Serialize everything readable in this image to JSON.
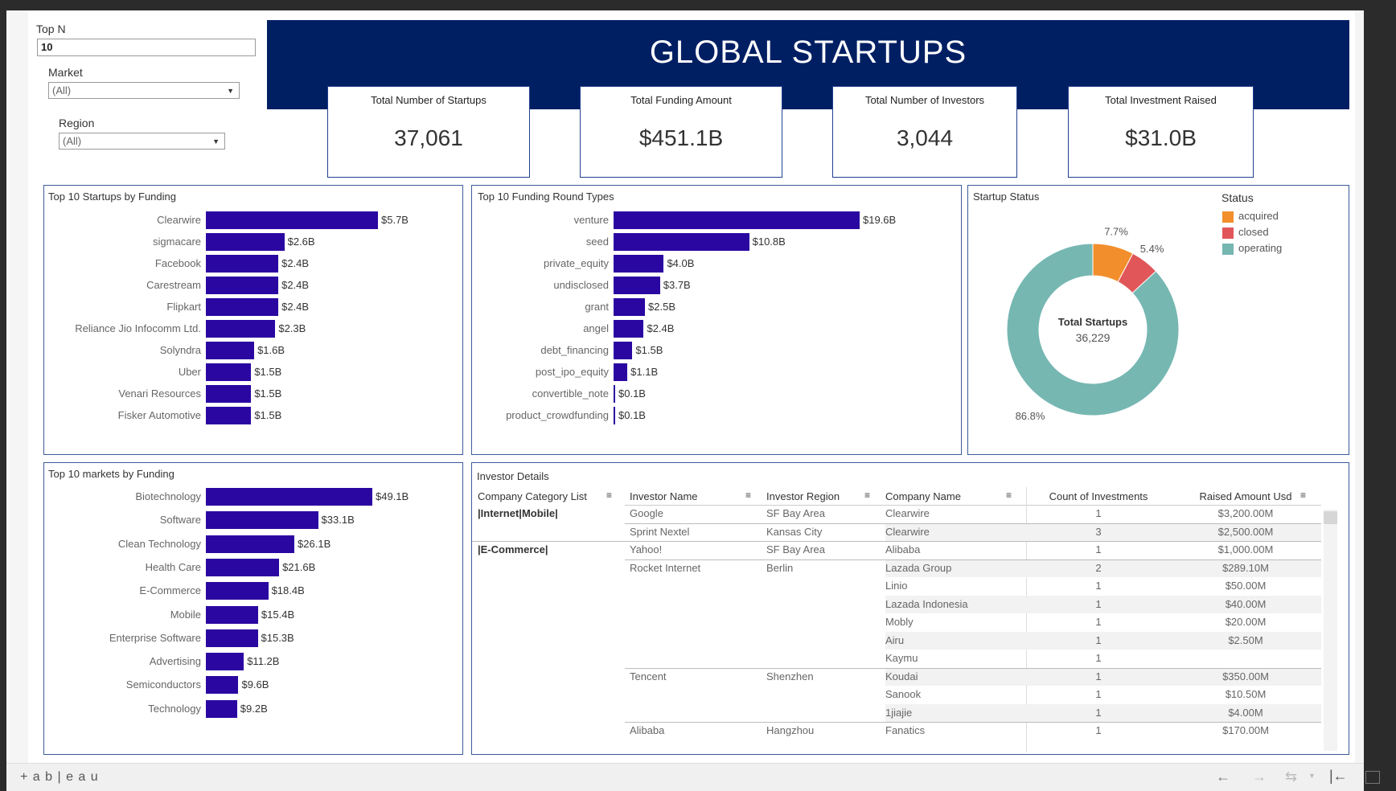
{
  "filters": {
    "topn_label": "Top N",
    "topn_value": "10",
    "market_label": "Market",
    "market_value": "(All)",
    "region_label": "Region",
    "region_value": "(All)"
  },
  "banner": {
    "title": "GLOBAL STARTUPS"
  },
  "kpis": [
    {
      "label": "Total Number of Startups",
      "value": "37,061"
    },
    {
      "label": "Total Funding Amount",
      "value": "$451.1B"
    },
    {
      "label": "Total Number of Investors",
      "value": "3,044"
    },
    {
      "label": "Total Investment Raised",
      "value": "$31.0B"
    }
  ],
  "startups_chart": {
    "title": "Top 10  Startups by Funding",
    "bar_color": "#2b07a1",
    "chart_data": {
      "type": "bar",
      "categories": [
        "Clearwire",
        "sigmacare",
        "Facebook",
        "Carestream",
        "Flipkart",
        "Reliance Jio Infocomm Ltd.",
        "Solyndra",
        "Uber",
        "Venari Resources",
        "Fisker Automotive"
      ],
      "values": [
        5.7,
        2.6,
        2.4,
        2.4,
        2.4,
        2.3,
        1.6,
        1.5,
        1.5,
        1.5
      ],
      "labels": [
        "$5.7B",
        "$2.6B",
        "$2.4B",
        "$2.4B",
        "$2.4B",
        "$2.3B",
        "$1.6B",
        "$1.5B",
        "$1.5B",
        "$1.5B"
      ],
      "xlim": [
        0,
        5.7
      ]
    }
  },
  "rounds_chart": {
    "title": "Top 10  Funding Round Types",
    "chart_data": {
      "type": "bar",
      "categories": [
        "venture",
        "seed",
        "private_equity",
        "undisclosed",
        "grant",
        "angel",
        "debt_financing",
        "post_ipo_equity",
        "convertible_note",
        "product_crowdfunding"
      ],
      "values": [
        19.6,
        10.8,
        4.0,
        3.7,
        2.5,
        2.4,
        1.5,
        1.1,
        0.1,
        0.05
      ],
      "labels": [
        "$19.6B",
        "$10.8B",
        "$4.0B",
        "$3.7B",
        "$2.5B",
        "$2.4B",
        "$1.5B",
        "$1.1B",
        "$0.1B",
        "$0.1B"
      ],
      "xlim": [
        0,
        19.6
      ]
    }
  },
  "status_chart": {
    "title": "Startup Status",
    "legend_title": "Status",
    "center_label": "Total Startups",
    "center_value": "36,229",
    "chart_data": {
      "type": "pie",
      "categories": [
        "acquired",
        "closed",
        "operating"
      ],
      "values": [
        7.7,
        5.4,
        86.8
      ],
      "labels": [
        "7.7%",
        "5.4%",
        "86.8%"
      ],
      "colors": [
        "#f28e2b",
        "#e15759",
        "#76b7b2"
      ]
    }
  },
  "markets_chart": {
    "title": "Top 10  markets by Funding",
    "chart_data": {
      "type": "bar",
      "categories": [
        "Biotechnology",
        "Software",
        "Clean Technology",
        "Health Care",
        "E-Commerce",
        "Mobile",
        "Enterprise Software",
        "Advertising",
        "Semiconductors",
        "Technology"
      ],
      "values": [
        49.1,
        33.1,
        26.1,
        21.6,
        18.4,
        15.4,
        15.3,
        11.2,
        9.6,
        9.2
      ],
      "labels": [
        "$49.1B",
        "$33.1B",
        "$26.1B",
        "$21.6B",
        "$18.4B",
        "$15.4B",
        "$15.3B",
        "$11.2B",
        "$9.6B",
        "$9.2B"
      ],
      "xlim": [
        0,
        49.1
      ]
    }
  },
  "investor_table": {
    "title": "Investor Details",
    "headers": [
      "Company Category List",
      "Investor Name",
      "Investor Region",
      "Company Name",
      "Count of Investments",
      "Raised Amount Usd"
    ],
    "rows": [
      {
        "cat": "|Internet|Mobile|",
        "inv": "Google",
        "reg": "SF Bay Area",
        "co": "Clearwire",
        "cnt": "1",
        "amt": "$3,200.00M"
      },
      {
        "cat": "",
        "inv": "Sprint Nextel",
        "reg": "Kansas City",
        "co": "Clearwire",
        "cnt": "3",
        "amt": "$2,500.00M"
      },
      {
        "cat": "|E-Commerce|",
        "inv": "Yahoo!",
        "reg": "SF Bay Area",
        "co": "Alibaba",
        "cnt": "1",
        "amt": "$1,000.00M"
      },
      {
        "cat": "",
        "inv": "Rocket Internet",
        "reg": "Berlin",
        "co": "Lazada Group",
        "cnt": "2",
        "amt": "$289.10M"
      },
      {
        "cat": "",
        "inv": "",
        "reg": "",
        "co": "Linio",
        "cnt": "1",
        "amt": "$50.00M"
      },
      {
        "cat": "",
        "inv": "",
        "reg": "",
        "co": "Lazada Indonesia",
        "cnt": "1",
        "amt": "$40.00M"
      },
      {
        "cat": "",
        "inv": "",
        "reg": "",
        "co": "Mobly",
        "cnt": "1",
        "amt": "$20.00M"
      },
      {
        "cat": "",
        "inv": "",
        "reg": "",
        "co": "Airu",
        "cnt": "1",
        "amt": "$2.50M"
      },
      {
        "cat": "",
        "inv": "",
        "reg": "",
        "co": "Kaymu",
        "cnt": "1",
        "amt": ""
      },
      {
        "cat": "",
        "inv": "Tencent",
        "reg": "Shenzhen",
        "co": "Koudai",
        "cnt": "1",
        "amt": "$350.00M"
      },
      {
        "cat": "",
        "inv": "",
        "reg": "",
        "co": "Sanook",
        "cnt": "1",
        "amt": "$10.50M"
      },
      {
        "cat": "",
        "inv": "",
        "reg": "",
        "co": "1jiajie",
        "cnt": "1",
        "amt": "$4.00M"
      },
      {
        "cat": "",
        "inv": "Alibaba",
        "reg": "Hangzhou",
        "co": "Fanatics",
        "cnt": "1",
        "amt": "$170.00M"
      }
    ]
  },
  "footer": {
    "brand": "+ a b | e a u",
    "logo_icon": "tableau-logo-icon"
  }
}
